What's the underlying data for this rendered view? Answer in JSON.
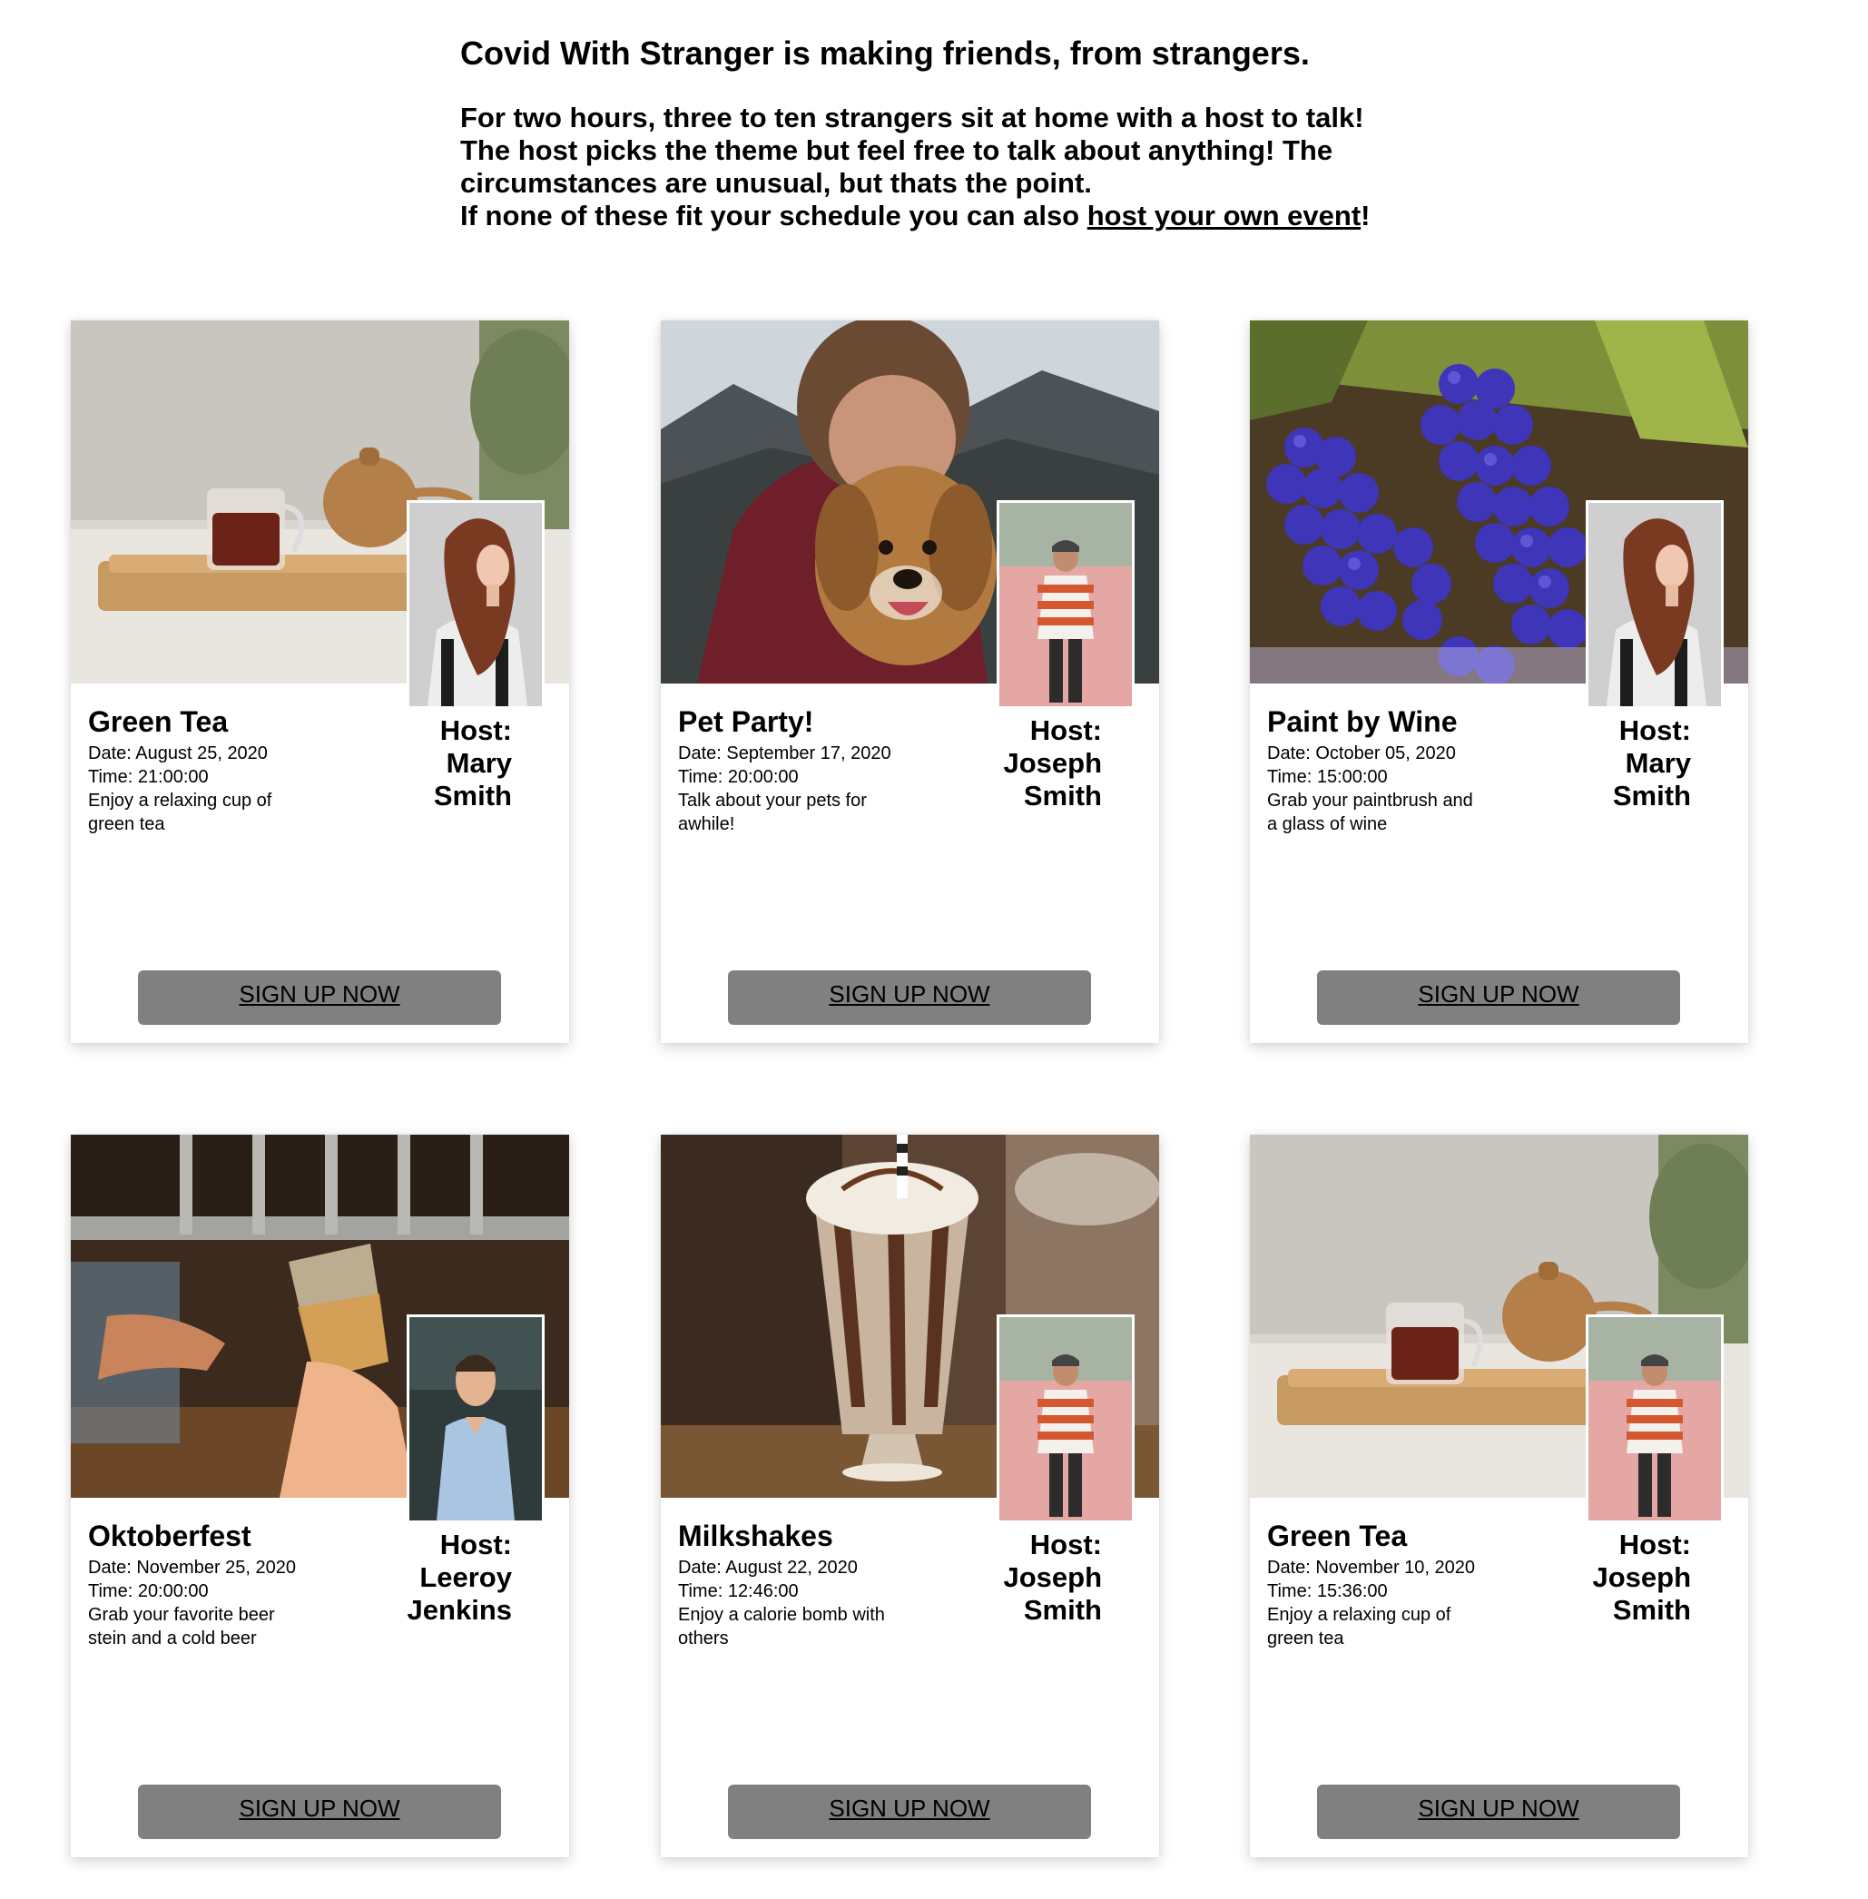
{
  "header": {
    "title": "Covid With Stranger is making friends, from strangers.",
    "desc_line1": "For two hours, three to ten strangers sit at home with a host to talk!",
    "desc_line2": "The host picks the theme but feel free to talk about anything! The",
    "desc_line3": "circumstances are unusual, but thats the point.",
    "desc_line4_prefix": "If none of these fit your schedule you can also ",
    "desc_link": "host your own event",
    "desc_line4_suffix": "!"
  },
  "events": [
    {
      "title": "Green Tea",
      "date": "Date: August 25, 2020",
      "time": "Time: 21:00:00",
      "description": "Enjoy a relaxing cup of green tea",
      "host_label": "Host:",
      "host_first": "Mary",
      "host_last": "Smith",
      "button": "SIGN UP NOW",
      "cover": "tea-photo",
      "avatar": "host-photo-mary"
    },
    {
      "title": "Pet Party!",
      "date": "Date: September 17, 2020",
      "time": "Time: 20:00:00",
      "description": "Talk about your pets for awhile!",
      "host_label": "Host:",
      "host_first": "Joseph",
      "host_last": "Smith",
      "button": "SIGN UP NOW",
      "cover": "dog-hug-photo",
      "avatar": "host-photo-joseph"
    },
    {
      "title": "Paint by Wine",
      "date": "Date: October 05, 2020",
      "time": "Time: 15:00:00",
      "description": "Grab your paintbrush and a glass of wine",
      "host_label": "Host:",
      "host_first": "Mary",
      "host_last": "Smith",
      "button": "SIGN UP NOW",
      "cover": "grapes-photo",
      "avatar": "host-photo-mary"
    },
    {
      "title": "Oktoberfest",
      "date": "Date: November 25, 2020",
      "time": "Time: 20:00:00",
      "description": "Grab your favorite beer stein and a cold beer",
      "host_label": "Host:",
      "host_first": "Leeroy",
      "host_last": "Jenkins",
      "button": "SIGN UP NOW",
      "cover": "beer-tap-photo",
      "avatar": "host-photo-leeroy"
    },
    {
      "title": "Milkshakes",
      "date": "Date: August 22, 2020",
      "time": "Time: 12:46:00",
      "description": "Enjoy a calorie bomb with others",
      "host_label": "Host:",
      "host_first": "Joseph",
      "host_last": "Smith",
      "button": "SIGN UP NOW",
      "cover": "milkshake-photo",
      "avatar": "host-photo-joseph"
    },
    {
      "title": "Green Tea",
      "date": "Date: November 10, 2020",
      "time": "Time: 15:36:00",
      "description": "Enjoy a relaxing cup of green tea",
      "host_label": "Host:",
      "host_first": "Joseph",
      "host_last": "Smith",
      "button": "SIGN UP NOW",
      "cover": "tea-photo",
      "avatar": "host-photo-joseph"
    }
  ],
  "colors": {
    "button_bg": "#808080",
    "card_bg": "#ffffff",
    "text": "#000000"
  }
}
